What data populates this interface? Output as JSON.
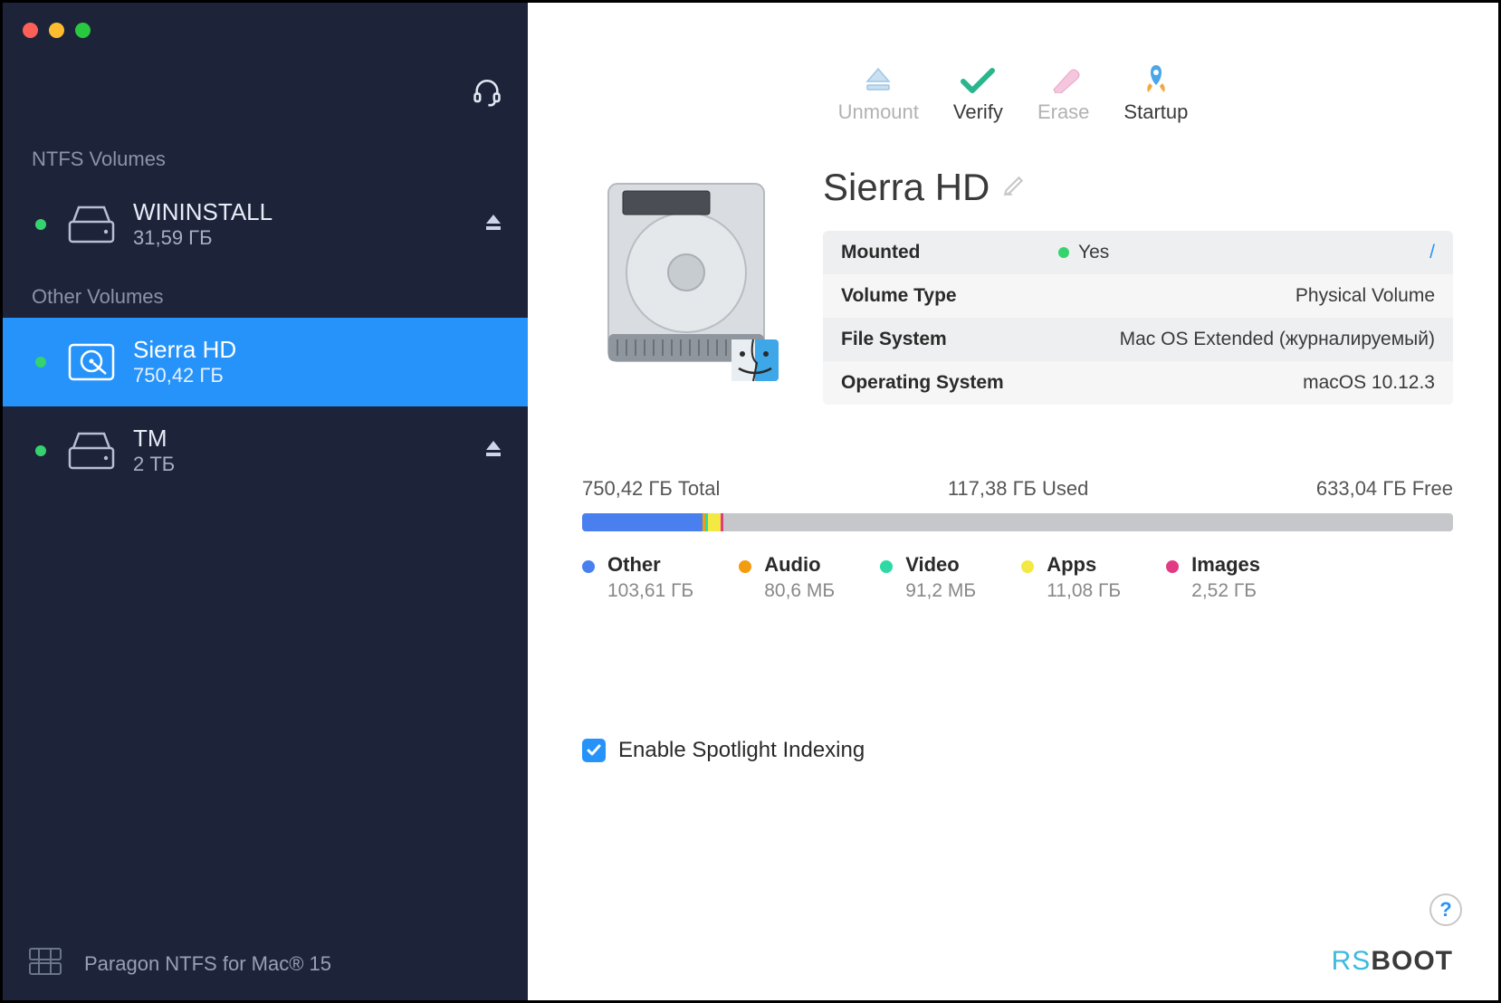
{
  "sidebar": {
    "section_ntfs": "NTFS Volumes",
    "section_other": "Other Volumes",
    "volumes": [
      {
        "name": "WININSTALL",
        "size": "31,59 ГБ"
      },
      {
        "name": "Sierra HD",
        "size": "750,42 ГБ"
      },
      {
        "name": "TM",
        "size": "2 ТБ"
      }
    ],
    "footer": "Paragon NTFS for Mac® 15"
  },
  "toolbar": {
    "unmount": "Unmount",
    "verify": "Verify",
    "erase": "Erase",
    "startup": "Startup"
  },
  "volume": {
    "title": "Sierra HD",
    "table": {
      "mounted_label": "Mounted",
      "mounted_value": "Yes",
      "mounted_slash": "/",
      "type_label": "Volume Type",
      "type_value": "Physical Volume",
      "fs_label": "File System",
      "fs_value": "Mac OS Extended (журналируемый)",
      "os_label": "Operating System",
      "os_value": "macOS 10.12.3"
    }
  },
  "usage": {
    "total": "750,42 ГБ Total",
    "used": "117,38 ГБ Used",
    "free": "633,04 ГБ Free",
    "segments": [
      {
        "label": "Other",
        "size": "103,61 ГБ",
        "color": "#4a7ff0",
        "pct": 13.8
      },
      {
        "label": "Audio",
        "size": "80,6 МБ",
        "color": "#f39c12",
        "pct": 0.3
      },
      {
        "label": "Video",
        "size": "91,2 МБ",
        "color": "#2ed9a4",
        "pct": 0.3
      },
      {
        "label": "Apps",
        "size": "11,08 ГБ",
        "color": "#f4e842",
        "pct": 1.5
      },
      {
        "label": "Images",
        "size": "2,52 ГБ",
        "color": "#e13b86",
        "pct": 0.34
      }
    ]
  },
  "spotlight": {
    "label": "Enable Spotlight Indexing"
  },
  "brand": {
    "rs": "RS",
    "boot": "BOOT"
  }
}
